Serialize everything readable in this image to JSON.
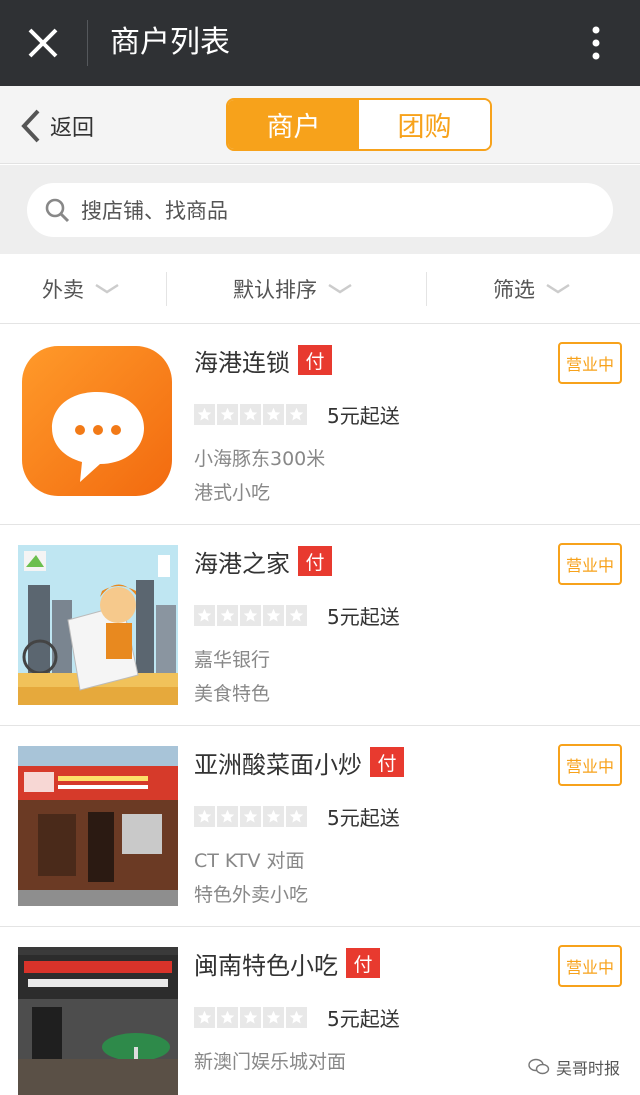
{
  "titlebar": {
    "title": "商户列表",
    "close_icon": "close-icon",
    "more_icon": "more-vertical-icon"
  },
  "nav": {
    "back_label": "返回",
    "tabs": [
      {
        "label": "商户",
        "active": true
      },
      {
        "label": "团购",
        "active": false
      }
    ]
  },
  "search": {
    "placeholder": "搜店铺、找商品"
  },
  "filters": [
    {
      "label": "外卖"
    },
    {
      "label": "默认排序"
    },
    {
      "label": "筛选"
    }
  ],
  "colors": {
    "accent": "#f7a21b",
    "pay_badge": "#e83a2f",
    "titlebar": "#2f3134"
  },
  "merchants": [
    {
      "name": "海港连锁",
      "pay_badge": "付",
      "status": "营业中",
      "rating": 0,
      "min_order": "5元起送",
      "address": "小海豚东300米",
      "category": "港式小吃"
    },
    {
      "name": "海港之家",
      "pay_badge": "付",
      "status": "营业中",
      "rating": 0,
      "min_order": "5元起送",
      "address": "嘉华银行",
      "category": "美食特色"
    },
    {
      "name": "亚洲酸菜面小炒",
      "pay_badge": "付",
      "status": "营业中",
      "rating": 0,
      "min_order": "5元起送",
      "address": "CT KTV 对面",
      "category": "特色外卖小吃"
    },
    {
      "name": "闽南特色小吃",
      "pay_badge": "付",
      "status": "营业中",
      "rating": 0,
      "min_order": "5元起送",
      "address": "新澳门娱乐城对面",
      "category": ""
    }
  ],
  "watermark": {
    "text": "吴哥时报"
  }
}
